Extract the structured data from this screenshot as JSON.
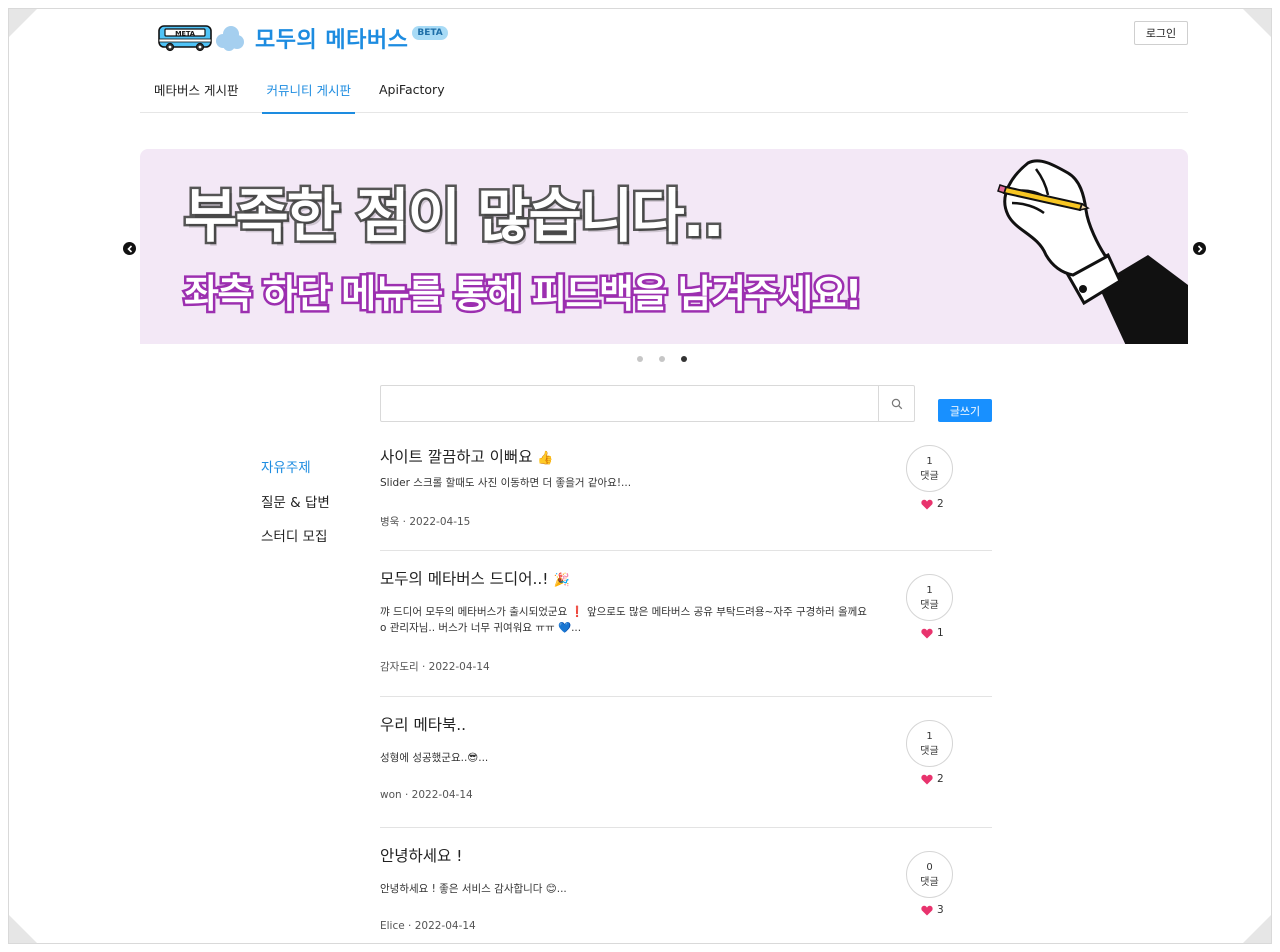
{
  "header": {
    "bus_sign": "META",
    "brand": "모두의 메타버스",
    "beta": "BETA",
    "login": "로그인"
  },
  "nav": {
    "tabs": [
      {
        "label": "메타버스 게시판",
        "active": false
      },
      {
        "label": "커뮤니티 게시판",
        "active": true
      },
      {
        "label": "ApiFactory",
        "active": false
      }
    ]
  },
  "banner": {
    "line1": "부족한 점이 많습니다..",
    "line2": "좌측 하단 메뉴를 통해 피드백을 남겨주세요!",
    "slides_total": 3,
    "slide_active": 3
  },
  "search": {
    "value": "",
    "placeholder": ""
  },
  "write_button": "글쓰기",
  "side_menu": {
    "items": [
      {
        "label": "자유주제",
        "active": true
      },
      {
        "label": "질문 & 답변",
        "active": false
      },
      {
        "label": "스터디 모집",
        "active": false
      }
    ]
  },
  "posts": [
    {
      "title": "사이트 깔끔하고 이뻐요",
      "title_emoji": "👍",
      "excerpt": "Slider 스크롤 할때도 사진 이동하면 더 좋을거 같아요!...",
      "meta": "병욱 · 2022-04-15",
      "comments": "1",
      "comments_label": "댓글",
      "likes": "2"
    },
    {
      "title": "모두의 메타버스 드디어..!",
      "title_emoji": "🎉",
      "excerpt": "꺄 드디어 모두의 메타버스가 출시되었군요 ❗ 앞으로도 많은 메타버스 공유 부탁드려용~자주 구경하러 올께요 o 관리자님.. 버스가 너무 귀여워요 ㅠㅠ 💙...",
      "meta": "감자도리 · 2022-04-14",
      "comments": "1",
      "comments_label": "댓글",
      "likes": "1"
    },
    {
      "title": "우리 메타북..",
      "title_emoji": "",
      "excerpt": "성형에 성공했군요..😎...",
      "meta": "won · 2022-04-14",
      "comments": "1",
      "comments_label": "댓글",
      "likes": "2"
    },
    {
      "title": "안녕하세요 !",
      "title_emoji": "",
      "excerpt": "안녕하세요 ! 좋은 서비스 감사합니다 😊...",
      "meta": "Elice · 2022-04-14",
      "comments": "0",
      "comments_label": "댓글",
      "likes": "3"
    }
  ],
  "colors": {
    "accent": "#1d8ce0",
    "write_button": "#1890ff",
    "banner_bg": "#f3e8f6",
    "banner_stroke_1": "#555555",
    "banner_stroke_2": "#9c2fb0",
    "heart": "#e8336d"
  },
  "icons": {
    "search": "search-icon",
    "prev": "chevron-left-icon",
    "next": "chevron-right-icon",
    "like": "heart-icon"
  }
}
